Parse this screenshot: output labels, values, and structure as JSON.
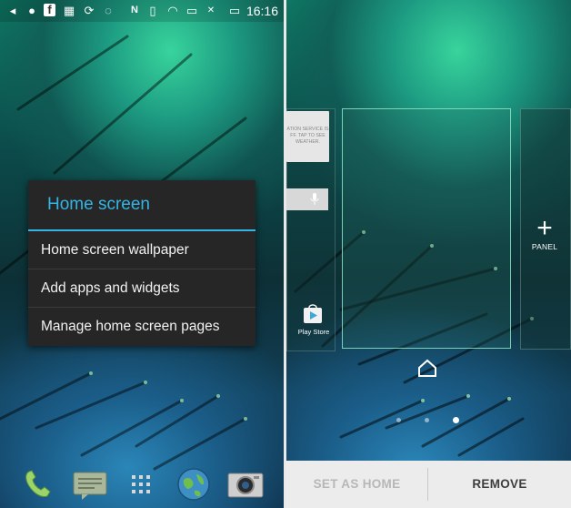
{
  "status_bar": {
    "time": "16:16",
    "icons": [
      "back-icon",
      "contact-icon",
      "facebook-icon",
      "calendar-icon",
      "sync-icon",
      "loading-icon",
      "nfc-icon",
      "vibrate-icon",
      "wifi-icon",
      "sim-icon",
      "no-signal-icon",
      "battery-icon"
    ]
  },
  "menu": {
    "title": "Home screen",
    "items": [
      {
        "label": "Home screen wallpaper"
      },
      {
        "label": "Add apps and widgets"
      },
      {
        "label": "Manage home screen pages"
      }
    ],
    "accent_color": "#33b5e5"
  },
  "dock": {
    "icons": [
      "phone-icon",
      "messages-icon",
      "app-drawer-icon",
      "browser-icon",
      "camera-icon"
    ]
  },
  "page_manager": {
    "weather_text": "LOCATION SERVICE IS OFF. TAP TO SEE WEATHER.",
    "weather_lines": [
      "ATION SERVICE IS",
      "FF. TAP TO SEE",
      "WEATHER."
    ],
    "play_store_label": "Play Store",
    "panel_label": "PANEL",
    "page_count": 3,
    "active_page": 3
  },
  "action_bar": {
    "set_as_home_label": "SET AS HOME",
    "remove_label": "REMOVE"
  }
}
